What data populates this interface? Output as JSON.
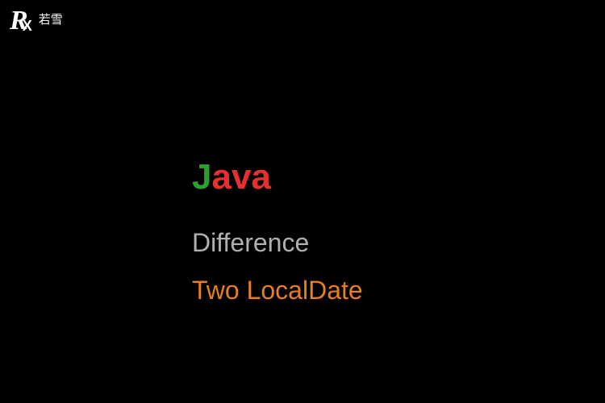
{
  "logo": {
    "r": "R",
    "x": "X",
    "text": "若雪"
  },
  "title": {
    "first_char": "J",
    "rest": "ava"
  },
  "subtitle1": "Difference",
  "subtitle2": "Two LocalDate"
}
